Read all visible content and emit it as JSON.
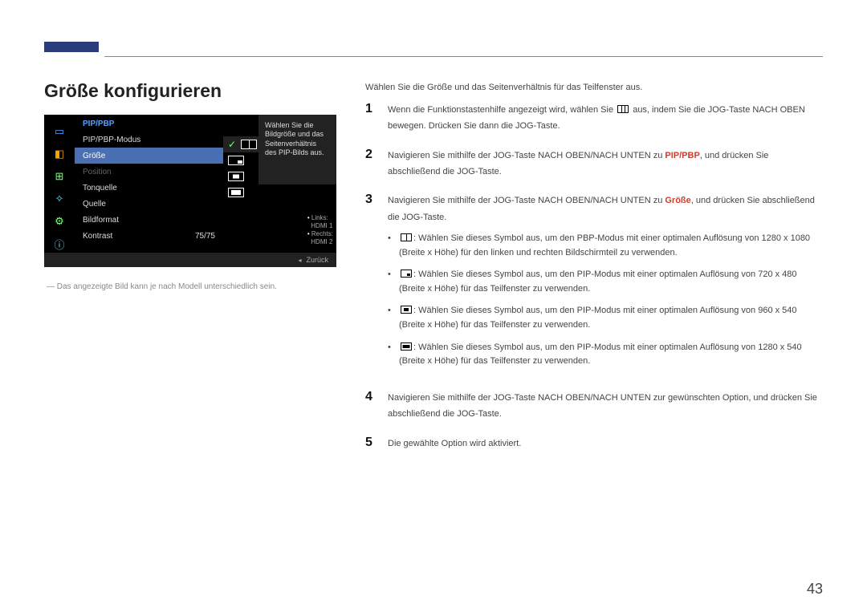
{
  "page_number": "43",
  "title": "Größe konfigurieren",
  "intro": "Wählen Sie die Größe und das Seitenverhältnis für das Teilfenster aus.",
  "footnote": "― Das angezeigte Bild kann je nach Modell unterschiedlich sein.",
  "osd": {
    "header": "PIP/PBP",
    "items": {
      "mode": "PIP/PBP-Modus",
      "size": "Größe",
      "position": "Position",
      "sound": "Tonquelle",
      "source": "Quelle",
      "format": "Bildformat",
      "contrast": "Kontrast"
    },
    "contrast_value": "75/75",
    "tip": "Wählen Sie die Bildgröße und das Seitenverhältnis des PIP-Bilds aus.",
    "info": {
      "left_label": "Links:",
      "left_value": "HDMI 1",
      "right_label": "Rechts:",
      "right_value": "HDMI 2"
    },
    "back": "Zurück"
  },
  "steps": {
    "s1a": "Wenn die Funktionstastenhilfe angezeigt wird, wählen Sie ",
    "s1b": " aus, indem Sie die JOG-Taste NACH OBEN bewegen. Drücken Sie dann die JOG-Taste.",
    "s2a": "Navigieren Sie mithilfe der JOG-Taste NACH OBEN/NACH UNTEN zu ",
    "s2_key": "PIP/PBP",
    "s2b": ", und drücken Sie abschließend die JOG-Taste.",
    "s3a": "Navigieren Sie mithilfe der JOG-Taste NACH OBEN/NACH UNTEN zu ",
    "s3_key": "Größe",
    "s3b": ", und drücken Sie abschließend die JOG-Taste.",
    "b1": ": Wählen Sie dieses Symbol aus, um den PBP-Modus mit einer optimalen Auflösung von 1280 x 1080 (Breite x Höhe) für den linken und rechten Bildschirmteil zu verwenden.",
    "b2": ": Wählen Sie dieses Symbol aus, um den PIP-Modus mit einer optimalen Auflösung von 720 x 480 (Breite x Höhe) für das Teilfenster zu verwenden.",
    "b3": ": Wählen Sie dieses Symbol aus, um den PIP-Modus mit einer optimalen Auflösung von 960 x 540 (Breite x Höhe) für das Teilfenster zu verwenden.",
    "b4": ": Wählen Sie dieses Symbol aus, um den PIP-Modus mit einer optimalen Auflösung von 1280 x 540 (Breite x Höhe) für das Teilfenster zu verwenden.",
    "s4": "Navigieren Sie mithilfe der JOG-Taste NACH OBEN/NACH UNTEN zur gewünschten Option, und drücken Sie abschließend die JOG-Taste.",
    "s5": "Die gewählte Option wird aktiviert."
  }
}
